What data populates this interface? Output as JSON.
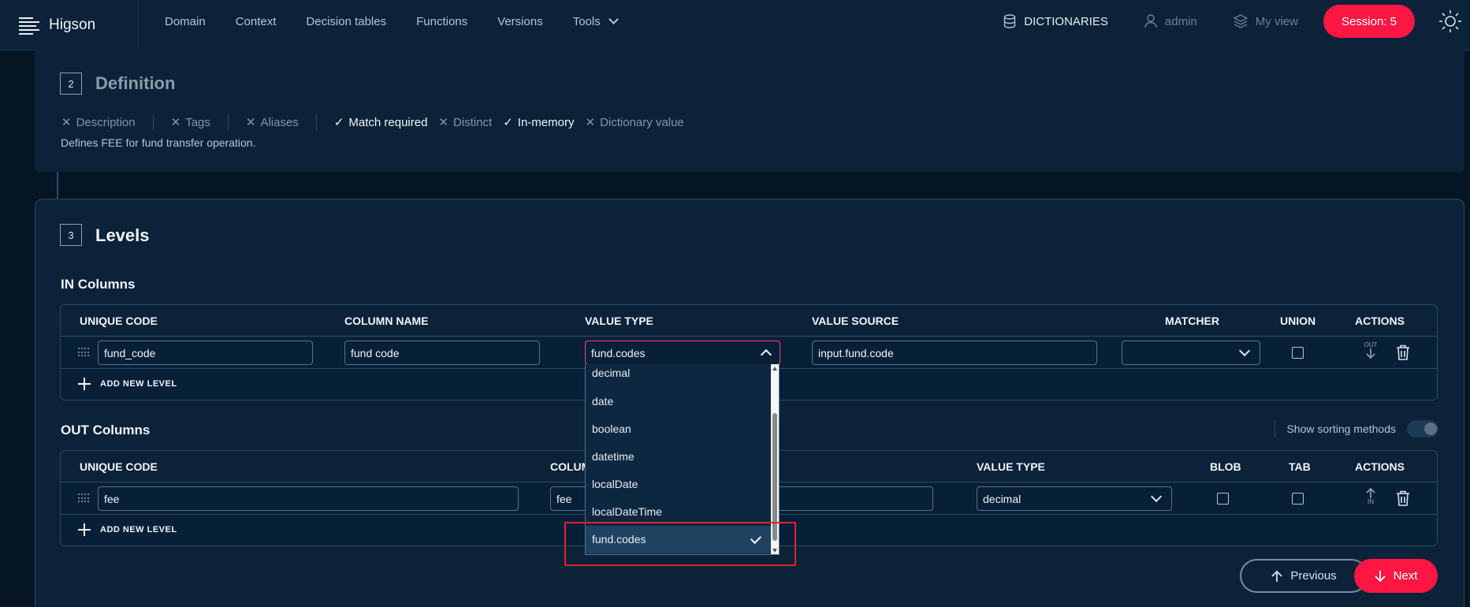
{
  "app": {
    "name": "Higson"
  },
  "nav": {
    "items": [
      {
        "label": "Domain"
      },
      {
        "label": "Context"
      },
      {
        "label": "Decision tables"
      },
      {
        "label": "Functions"
      },
      {
        "label": "Versions"
      },
      {
        "label": "Tools"
      }
    ],
    "dictionaries": "DICTIONARIES",
    "user": "admin",
    "my_view": "My view",
    "session": "Session: 5"
  },
  "definition": {
    "step": "2",
    "title": "Definition",
    "flags": [
      {
        "label": "Description",
        "enabled": false
      },
      {
        "label": "Tags",
        "enabled": false
      },
      {
        "label": "Aliases",
        "enabled": false
      },
      {
        "label": "Match required",
        "enabled": true
      },
      {
        "label": "Distinct",
        "enabled": false
      },
      {
        "label": "In-memory",
        "enabled": true
      },
      {
        "label": "Dictionary value",
        "enabled": false
      }
    ],
    "description": "Defines FEE for fund transfer operation."
  },
  "levels": {
    "step": "3",
    "title": "Levels",
    "in_columns": {
      "title": "IN Columns",
      "headers": [
        "UNIQUE CODE",
        "COLUMN NAME",
        "VALUE TYPE",
        "VALUE SOURCE",
        "MATCHER",
        "UNION",
        "ACTIONS"
      ],
      "row": {
        "unique_code": "fund_code",
        "column_name": "fund code",
        "value_type": "fund.codes",
        "value_source": "input.fund.code",
        "matcher": "",
        "direction": "OUT"
      },
      "add_label": "ADD NEW LEVEL"
    },
    "out_columns": {
      "title": "OUT Columns",
      "show_sorting": "Show sorting methods",
      "headers": [
        "UNIQUE CODE",
        "COLUMN NAME",
        "VALUE TYPE",
        "BLOB",
        "TAB",
        "ACTIONS"
      ],
      "row": {
        "unique_code": "fee",
        "column_name": "fee",
        "value_type": "decimal",
        "direction": "IN"
      },
      "add_label": "ADD NEW LEVEL"
    }
  },
  "value_type_dropdown": {
    "options": [
      "decimal",
      "date",
      "boolean",
      "datetime",
      "localDate",
      "localDateTime",
      "fund.codes"
    ],
    "selected": "fund.codes"
  },
  "footer": {
    "previous": "Previous",
    "next": "Next"
  }
}
